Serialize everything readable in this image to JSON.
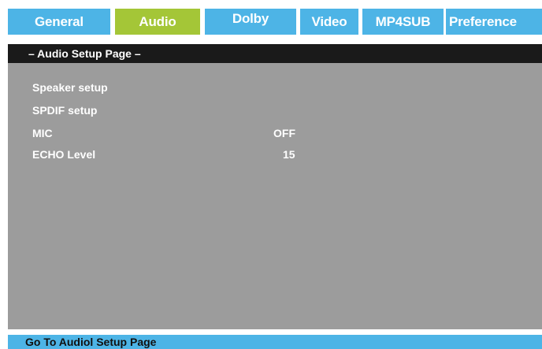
{
  "tabs": [
    {
      "label": "General",
      "active": false
    },
    {
      "label": "Audio",
      "active": true
    },
    {
      "label": "Dolby",
      "active": false
    },
    {
      "label": "Video",
      "active": false
    },
    {
      "label": "MP4SUB",
      "active": false
    },
    {
      "label": "Preference",
      "active": false
    }
  ],
  "panel": {
    "title": "– Audio Setup Page –",
    "items": [
      {
        "label": "Speaker setup",
        "value": ""
      },
      {
        "label": "SPDIF setup",
        "value": ""
      },
      {
        "label": "MIC",
        "value": "OFF"
      },
      {
        "label": "ECHO Level",
        "value": "15"
      }
    ]
  },
  "status": "Go To Audiol Setup Page",
  "colors": {
    "tab_inactive": "#4db4e6",
    "tab_active": "#a4c637",
    "panel_bg": "#9c9c9c",
    "panel_header": "#1a1a1a",
    "status_bar": "#4db4e6"
  }
}
